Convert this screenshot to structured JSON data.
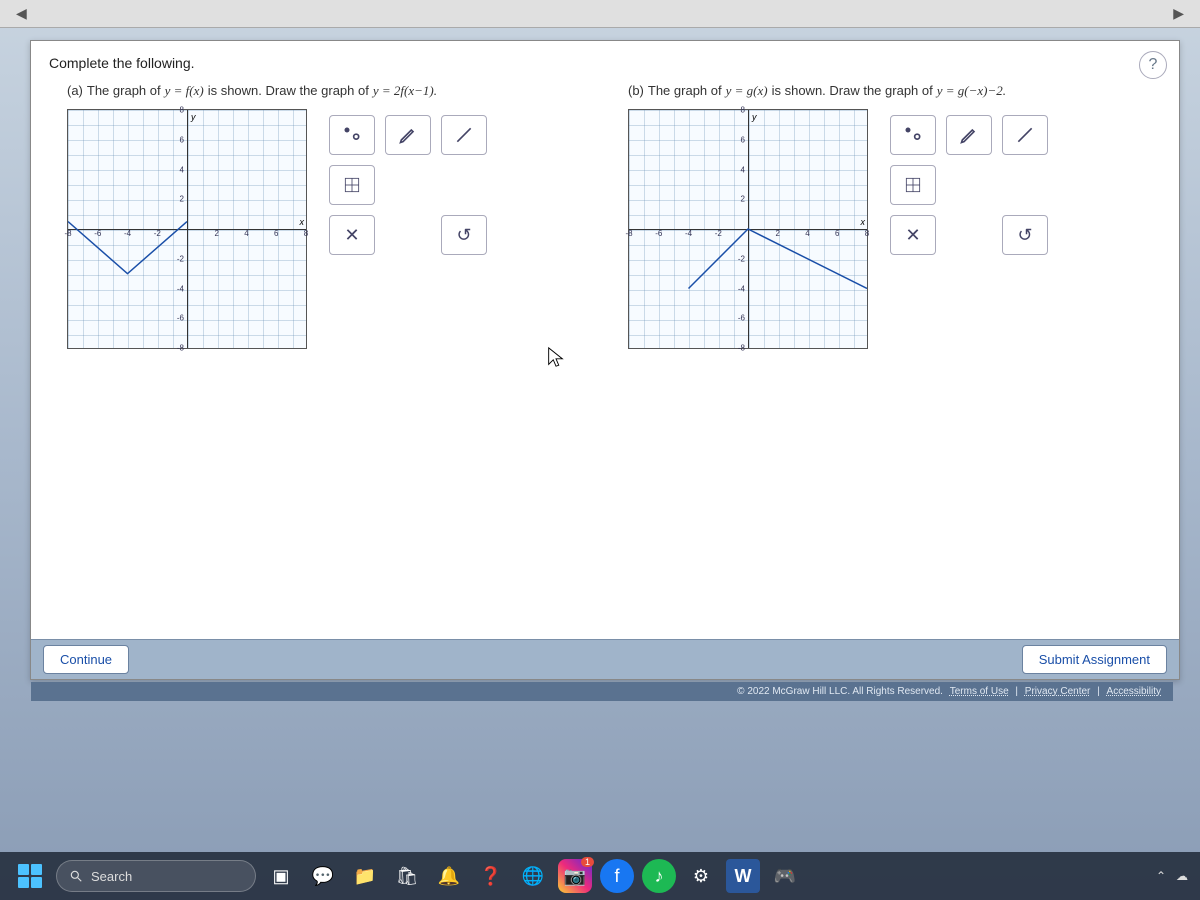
{
  "browser": {
    "back": "◀",
    "forward": "▶"
  },
  "instruction": "Complete the following.",
  "help_label": "?",
  "parts": {
    "a": {
      "label": "(a)",
      "prompt_pre": "The graph of ",
      "eq1": "y = f(x)",
      "prompt_mid": " is shown. Draw the graph of ",
      "eq2": "y = 2f(x−1).",
      "axis_y_label": "y",
      "axis_x_label": "x"
    },
    "b": {
      "label": "(b)",
      "prompt_pre": "The graph of ",
      "eq1": "y = g(x)",
      "prompt_mid": " is shown. Draw the graph of ",
      "eq2": "y = g(−x)−2.",
      "axis_y_label": "y",
      "axis_x_label": "x"
    }
  },
  "ticks": {
    "x": [
      "-8",
      "-6",
      "-4",
      "-2",
      "2",
      "4",
      "6",
      "8"
    ],
    "y": [
      "8",
      "6",
      "4",
      "2",
      "-2",
      "-4",
      "-6",
      "-8"
    ]
  },
  "toolbox": {
    "point_draw": "point-pair-tool",
    "pencil": "pencil-tool",
    "segment": "segment-tool",
    "grid": "fill-grid-tool",
    "clear": "✕",
    "undo": "↺"
  },
  "buttons": {
    "continue": "Continue",
    "submit": "Submit Assignment"
  },
  "footer": {
    "copyright": "© 2022 McGraw Hill LLC. All Rights Reserved.",
    "terms": "Terms of Use",
    "privacy": "Privacy Center",
    "accessibility": "Accessibility"
  },
  "taskbar": {
    "search_placeholder": "Search",
    "badge_count": "1"
  },
  "chart_data": [
    {
      "type": "line",
      "title": "y = f(x)",
      "xlabel": "x",
      "ylabel": "y",
      "xlim": [
        -8,
        8
      ],
      "ylim": [
        -8,
        8
      ],
      "series": [
        {
          "name": "f(x)",
          "points": [
            [
              -8,
              1
            ],
            [
              -4,
              -3
            ],
            [
              0,
              1
            ]
          ]
        }
      ]
    },
    {
      "type": "line",
      "title": "y = g(x)",
      "xlabel": "x",
      "ylabel": "y",
      "xlim": [
        -8,
        8
      ],
      "ylim": [
        -8,
        8
      ],
      "series": [
        {
          "name": "g(x)",
          "points": [
            [
              -4,
              -4
            ],
            [
              0,
              0
            ],
            [
              8,
              -4
            ]
          ]
        }
      ]
    }
  ],
  "colors": {
    "accent": "#1a4fa8",
    "panel": "#a0b4ca",
    "bg_grad_top": "#c8d4e0"
  }
}
